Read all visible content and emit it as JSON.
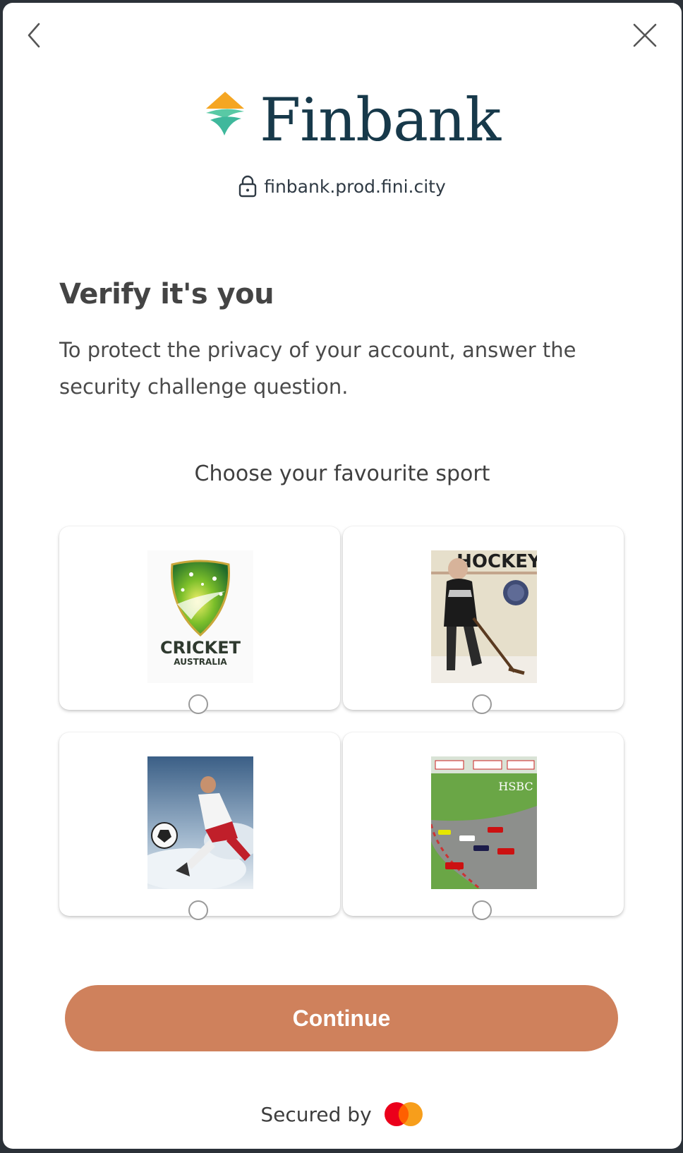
{
  "nav": {
    "back_icon": "chevron-left-icon",
    "close_icon": "close-icon"
  },
  "brand": {
    "name": "Finbank",
    "domain": "finbank.prod.fini.city",
    "lock_icon": "lock-icon",
    "colors": {
      "text": "#17394a",
      "orange": "#f5a623",
      "teal": "#4cc3a7"
    }
  },
  "heading": {
    "title": "Verify it's you",
    "description": "To protect the privacy of your account, answer the security challenge question."
  },
  "challenge": {
    "question": "Choose your favourite sport",
    "options": [
      {
        "image": "cricket-australia-logo",
        "image_text": "CRICKET",
        "image_subtext": "AUSTRALIA",
        "selected": false
      },
      {
        "image": "hockey-player-photo",
        "image_text": "HOCKEY",
        "selected": false
      },
      {
        "image": "soccer-player-photo",
        "selected": false
      },
      {
        "image": "formula-one-race-photo",
        "image_text": "HSBC",
        "selected": false
      }
    ]
  },
  "actions": {
    "continue_label": "Continue",
    "accent": "#cf815c"
  },
  "footer": {
    "secured_label": "Secured by",
    "brand_icon": "mastercard-icon"
  }
}
